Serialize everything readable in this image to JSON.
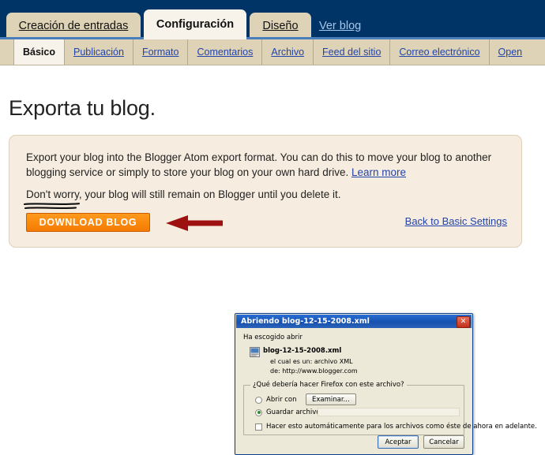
{
  "top_nav": {
    "tabs": [
      {
        "label": "Creación de entradas",
        "active": false
      },
      {
        "label": "Configuración",
        "active": true
      },
      {
        "label": "Diseño",
        "active": false
      }
    ],
    "view_blog_link": "Ver blog"
  },
  "sub_nav": {
    "tabs": [
      {
        "label": "Básico",
        "active": true
      },
      {
        "label": "Publicación",
        "active": false
      },
      {
        "label": "Formato",
        "active": false
      },
      {
        "label": "Comentarios",
        "active": false
      },
      {
        "label": "Archivo",
        "active": false
      },
      {
        "label": "Feed del sitio",
        "active": false
      },
      {
        "label": "Correo electrónico",
        "active": false
      },
      {
        "label": "Open",
        "active": false
      }
    ]
  },
  "main": {
    "page_title": "Exporta tu blog.",
    "panel": {
      "paragraph": "Export your blog into the Blogger Atom export format. You can do this to move your blog to another blogging service or simply to store your blog on your own hard drive.",
      "learn_more_link": "Learn more",
      "reassurance": "Don't worry, your blog will still remain on Blogger until you delete it.",
      "download_button": "DOWNLOAD BLOG",
      "back_link": "Back to Basic Settings"
    }
  },
  "dialog": {
    "title": "Abriendo blog-12-15-2008.xml",
    "close_label": "✕",
    "intro": "Ha escogido abrir",
    "file_name": "blog-12-15-2008.xml",
    "file_type_line": "el cual es un:  archivo XML",
    "file_from_line": "de:  http://www.blogger.com",
    "question": "¿Qué debería hacer Firefox con este archivo?",
    "option_open": "Abrir con",
    "browse_button": "Examinar...",
    "option_save": "Guardar archivo",
    "option_save_selected": true,
    "auto_checkbox": "Hacer esto automáticamente para los archivos como éste de ahora en adelante.",
    "auto_checked": false,
    "accept_button": "Aceptar",
    "cancel_button": "Cancelar"
  },
  "annotations": {
    "arrow_color": "#9e1111",
    "underline_color": "#111111"
  },
  "colors": {
    "nav_navy": "#003366",
    "tab_tan": "#ded3b6",
    "tab_active": "#f7f3ea",
    "panel_beige": "#f6ede0",
    "link_blue": "#2244aa",
    "orange_button": "#f57b00"
  }
}
